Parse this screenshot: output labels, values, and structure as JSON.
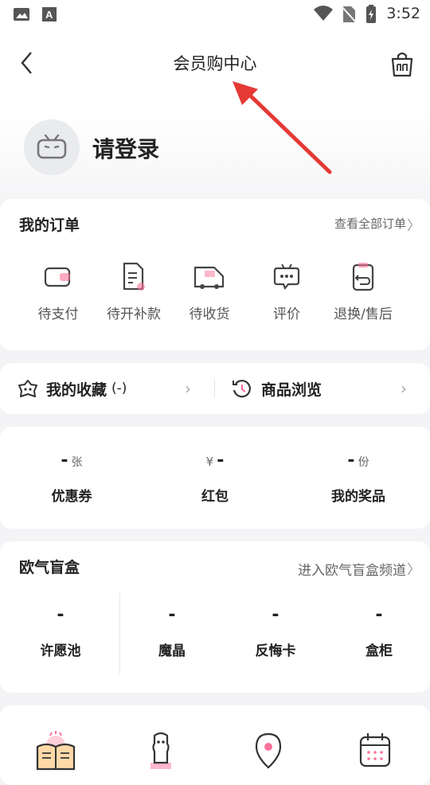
{
  "status_bar": {
    "time": "3:52"
  },
  "header": {
    "title": "会员购中心",
    "back_icon": "back-arrow-icon",
    "bag_icon": "shopping-bag-icon"
  },
  "profile": {
    "login_text": "请登录"
  },
  "orders": {
    "title": "我的订单",
    "view_all": "查看全部订单",
    "items": [
      {
        "label": "待支付",
        "icon": "wallet-icon"
      },
      {
        "label": "待开补款",
        "icon": "document-icon"
      },
      {
        "label": "待收货",
        "icon": "truck-icon"
      },
      {
        "label": "评价",
        "icon": "chat-icon"
      },
      {
        "label": "退换/售后",
        "icon": "return-icon"
      }
    ]
  },
  "favorites": {
    "favorites_label": "我的收藏",
    "favorites_count": "(-)",
    "history_label": "商品浏览"
  },
  "wallet": {
    "items": [
      {
        "value": "-",
        "unit": "张",
        "label": "优惠券"
      },
      {
        "currency": "¥",
        "value": "-",
        "label": "红包"
      },
      {
        "value": "-",
        "unit": "份",
        "label": "我的奖品"
      }
    ]
  },
  "blind_box": {
    "title": "欧气盲盒",
    "link": "进入欧气盲盒频道",
    "items": [
      {
        "value": "-",
        "label": "许愿池"
      },
      {
        "value": "-",
        "label": "魔晶"
      },
      {
        "value": "-",
        "label": "反悔卡"
      },
      {
        "value": "-",
        "label": "盒柜"
      }
    ]
  },
  "colors": {
    "accent": "#fb7299",
    "annotation_arrow": "#e53935"
  }
}
